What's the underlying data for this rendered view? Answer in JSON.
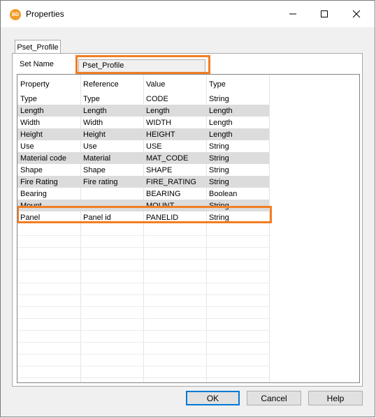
{
  "window": {
    "title": "Properties",
    "icon_text": "BD"
  },
  "tab": {
    "label": "Pset_Profile"
  },
  "set_name": {
    "label": "Set Name",
    "value": "Pset_Profile"
  },
  "grid": {
    "headers": [
      "Property",
      "Reference",
      "Value",
      "Type"
    ],
    "rows": [
      [
        "Type",
        "Type",
        "CODE",
        "String"
      ],
      [
        "Length",
        "Length",
        "Length",
        "Length"
      ],
      [
        "Width",
        "Width",
        "WIDTH",
        "Length"
      ],
      [
        "Height",
        "Height",
        "HEIGHT",
        "Length"
      ],
      [
        "Use",
        "Use",
        "USE",
        "String"
      ],
      [
        "Material code",
        "Material",
        "MAT_CODE",
        "String"
      ],
      [
        "Shape",
        "Shape",
        "SHAPE",
        "String"
      ],
      [
        "Fire Rating",
        "Fire rating",
        "FIRE_RATING",
        "String"
      ],
      [
        "Bearing",
        "",
        "BEARING",
        "Boolean"
      ],
      [
        "Mount",
        "",
        "MOUNT",
        "String"
      ],
      [
        "Panel",
        "Panel id",
        "PANELID",
        "String"
      ]
    ],
    "shaded_rows": [
      1,
      3,
      5,
      7,
      9
    ]
  },
  "buttons": {
    "ok": "OK",
    "cancel": "Cancel",
    "help": "Help"
  },
  "colors": {
    "highlight": "#f27e23",
    "accent": "#0078d7",
    "shaded_row": "#dcdcdc"
  }
}
